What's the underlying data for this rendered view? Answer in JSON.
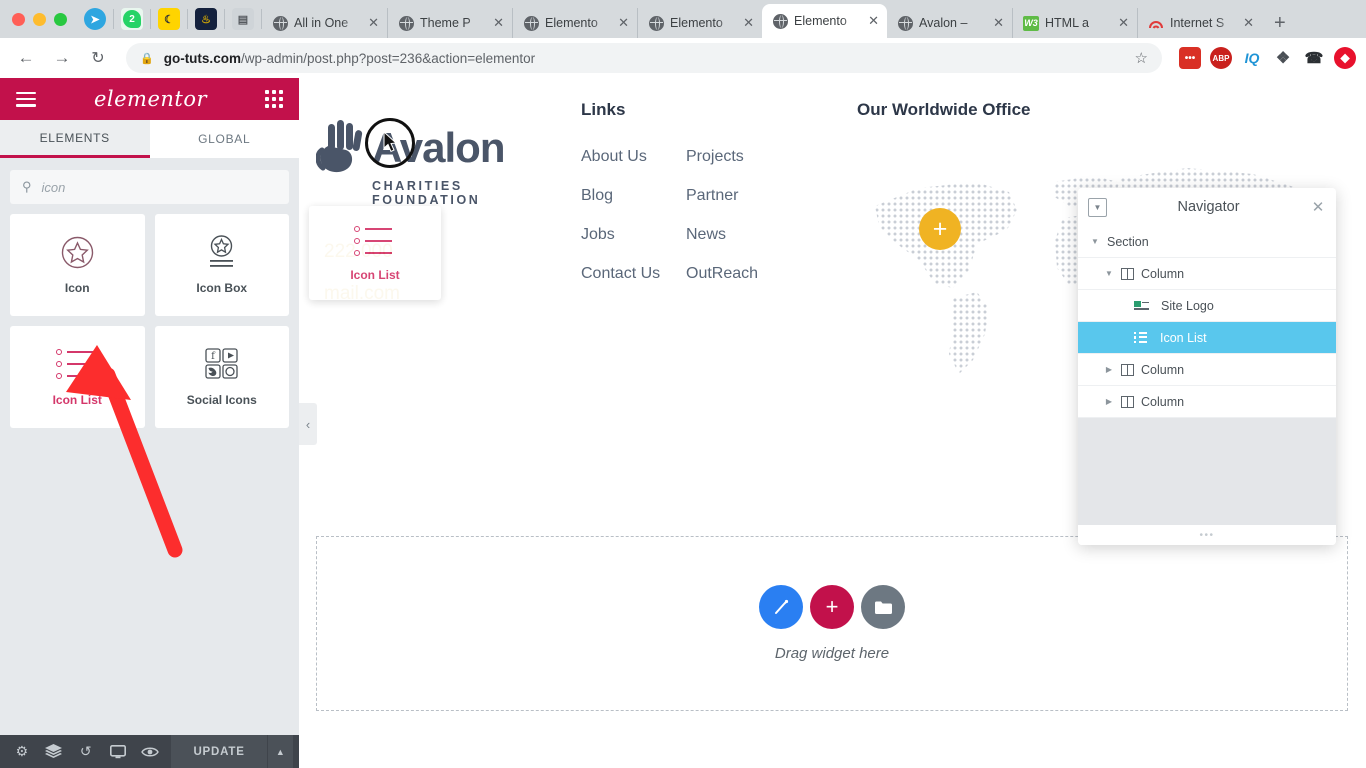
{
  "browser": {
    "traffic_lights": [
      "close",
      "minimize",
      "maximize"
    ],
    "extension_icons": [
      "telegram-icon",
      "whatsapp-icon",
      "cookie-icon",
      "dark-app-icon",
      "gray-app-icon"
    ],
    "whatsapp_badge": "2",
    "tabs": [
      {
        "title": "All in One",
        "favicon": "globe-icon",
        "active": false
      },
      {
        "title": "Theme P",
        "favicon": "globe-icon",
        "active": false
      },
      {
        "title": "Elemento",
        "favicon": "globe-icon",
        "active": false
      },
      {
        "title": "Elemento",
        "favicon": "globe-icon",
        "active": false
      },
      {
        "title": "Elemento",
        "favicon": "globe-icon",
        "active": true
      },
      {
        "title": "Avalon –",
        "favicon": "globe-icon",
        "active": false
      },
      {
        "title": "HTML a",
        "favicon": "w3c-icon",
        "active": false
      },
      {
        "title": "Internet S",
        "favicon": "arc-icon",
        "active": false
      }
    ],
    "new_tab_label": "+",
    "close_label": "✕",
    "nav": {
      "back": "←",
      "forward": "→",
      "reload": "↻"
    },
    "url": {
      "lock": "🔒",
      "host": "go-tuts.com",
      "path": "/wp-admin/post.php?post=236&action=elementor",
      "star": "☆"
    },
    "toolbar_icons": [
      {
        "name": "dots-extension-icon",
        "label": "•••"
      },
      {
        "name": "adblock-plus-icon",
        "label": "ABP"
      },
      {
        "name": "iq-extension-icon",
        "label": "IQ"
      },
      {
        "name": "puzzle-extensions-icon",
        "label": "❖"
      },
      {
        "name": "call-extension-icon",
        "label": "☎"
      },
      {
        "name": "record-extension-icon",
        "label": "⬢"
      }
    ]
  },
  "elementor_panel": {
    "logo": "elementor",
    "menu_icon": "hamburger-icon",
    "grid_icon": "app-grid-icon",
    "tabs": [
      {
        "label": "ELEMENTS",
        "active": true
      },
      {
        "label": "GLOBAL",
        "active": false
      }
    ],
    "search": {
      "value": "icon",
      "icon": "search-icon"
    },
    "widgets": [
      {
        "label": "Icon",
        "icon": "star-circle-icon",
        "selected": false
      },
      {
        "label": "Icon Box",
        "icon": "icon-box-icon",
        "selected": false
      },
      {
        "label": "Icon List",
        "icon": "icon-list-icon",
        "selected": true
      },
      {
        "label": "Social Icons",
        "icon": "social-icons-icon",
        "selected": false
      }
    ],
    "collapse_handle": "‹",
    "bottom_bar": {
      "icons": [
        {
          "name": "settings-gear-icon",
          "glyph": "⚙"
        },
        {
          "name": "layers-navigator-icon",
          "glyph": "≣"
        },
        {
          "name": "history-icon",
          "glyph": "↺"
        },
        {
          "name": "responsive-mode-icon",
          "glyph": "▭"
        },
        {
          "name": "preview-eye-icon",
          "glyph": "◉"
        }
      ],
      "update_label": "UPDATE",
      "caret": "▲"
    }
  },
  "drag_ghost": {
    "label": "Icon List",
    "icon": "icon-list-icon"
  },
  "canvas": {
    "logo_column": {
      "brand": "Avalon",
      "tagline": "CHARITIES FOUNDATION",
      "logo_icon": "hand-logo-icon",
      "contact": [
        {
          "text": "222 000",
          "partially_hidden": true
        },
        {
          "text": "mail.com",
          "partially_hidden": true
        }
      ]
    },
    "links_column": {
      "title": "Links",
      "links": [
        "About Us",
        "Projects",
        "Blog",
        "Partner",
        "Jobs",
        "News",
        "Contact Us",
        "OutReach"
      ]
    },
    "map_column": {
      "title": "Our Worldwide Office",
      "pin_icon": "plus-pin-icon"
    },
    "dropzone": {
      "text": "Drag widget here",
      "buttons": [
        {
          "name": "add-template-magic-button",
          "glyph": "✦",
          "color": "#2a7ff2"
        },
        {
          "name": "add-section-button",
          "glyph": "+",
          "color": "#c2114b"
        },
        {
          "name": "add-library-folder-button",
          "glyph": "▰",
          "color": "#6d7882"
        }
      ]
    }
  },
  "navigator": {
    "title": "Navigator",
    "dock_icon": "dock-toggle-icon",
    "close_icon": "✕",
    "resize_grip": "•••",
    "tree": [
      {
        "label": "Section",
        "depth": 0,
        "arrow": "down",
        "icon": null,
        "selected": false
      },
      {
        "label": "Column",
        "depth": 1,
        "arrow": "down",
        "icon": "column-icon",
        "selected": false
      },
      {
        "label": "Site Logo",
        "depth": 2,
        "arrow": "none",
        "icon": "site-logo-icon",
        "selected": false
      },
      {
        "label": "Icon List",
        "depth": 2,
        "arrow": "none",
        "icon": "icon-list-icon",
        "selected": true
      },
      {
        "label": "Column",
        "depth": 1,
        "arrow": "right",
        "icon": "column-icon",
        "selected": false
      },
      {
        "label": "Column",
        "depth": 1,
        "arrow": "right",
        "icon": "column-icon",
        "selected": false
      }
    ]
  },
  "annotation": {
    "arrow_color": "#fc2d2d",
    "cursor": "drag-cursor-highlight"
  },
  "colors": {
    "elementor_pink": "#c2114b",
    "navigator_selected": "#59c7ed",
    "accent_gold": "#d7a10b",
    "brand_slate": "#4a5568"
  }
}
